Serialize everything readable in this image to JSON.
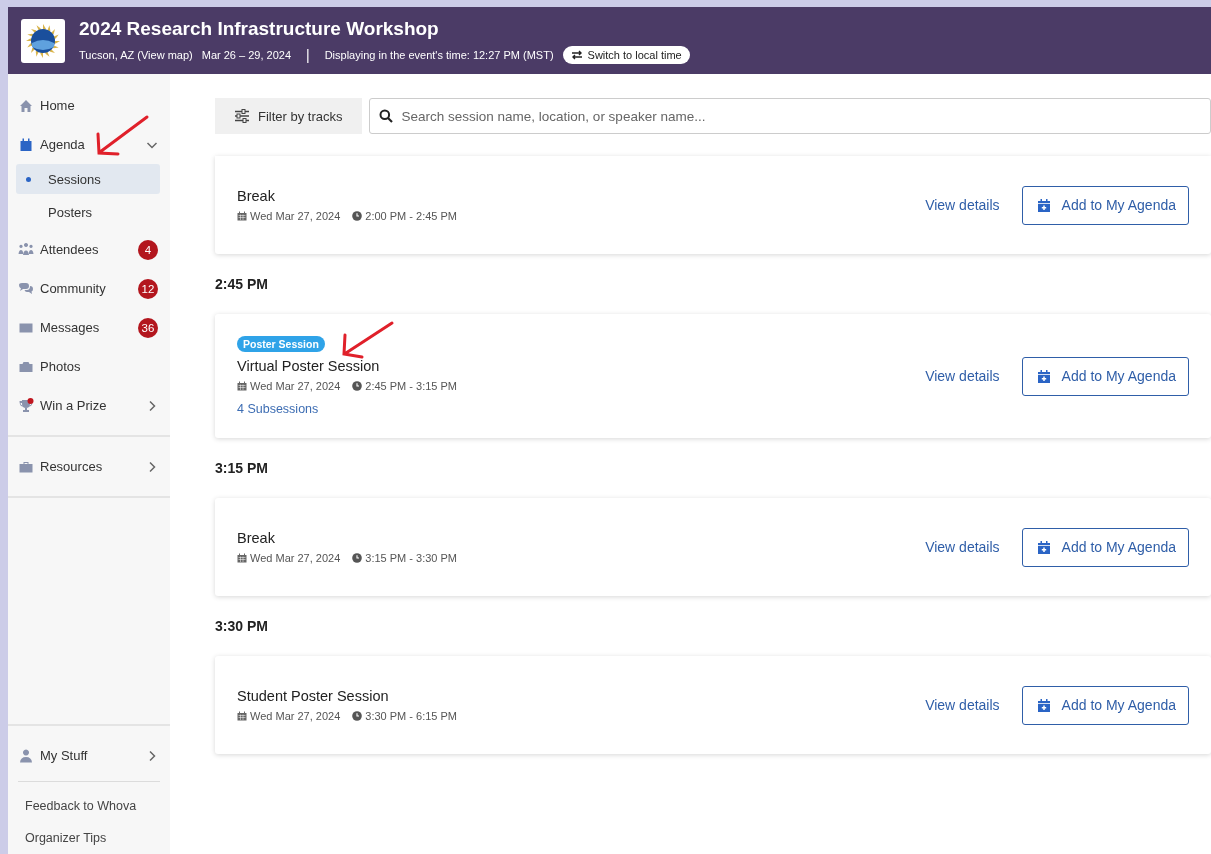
{
  "header": {
    "title": "2024 Research Infrastructure Workshop",
    "location": "Tucson, AZ (View map)",
    "dates": "Mar 26 – 29, 2024",
    "separator": "|",
    "timezone_note": "Displaying in the event's time: 12:27 PM (MST)",
    "switch_button": "Switch to local time"
  },
  "sidebar": {
    "groups": [
      [
        {
          "label": "Home",
          "kind": "home",
          "selected": false
        },
        {
          "label": "Agenda",
          "kind": "calendar",
          "selected": true,
          "expanded": true,
          "children": [
            {
              "label": "Sessions",
              "selected": true
            },
            {
              "label": "Posters",
              "selected": false
            }
          ]
        },
        {
          "label": "Attendees",
          "kind": "people",
          "selected": false,
          "badge": "4"
        },
        {
          "label": "Community",
          "kind": "chat",
          "selected": false,
          "badge": "12"
        },
        {
          "label": "Messages",
          "kind": "mail",
          "selected": false,
          "badge": "36"
        },
        {
          "label": "Photos",
          "kind": "camera",
          "selected": false
        },
        {
          "label": "Win a Prize",
          "kind": "trophy",
          "selected": false,
          "notification": true,
          "expanded": false
        }
      ],
      [
        {
          "label": "Resources",
          "kind": "briefcase",
          "selected": false,
          "expanded": false
        }
      ]
    ],
    "bottom": [
      {
        "label": "My Stuff",
        "kind": "person",
        "selected": false,
        "expanded": false
      }
    ],
    "links": [
      "Feedback to Whova",
      "Organizer Tips"
    ]
  },
  "toolbar": {
    "filter_button": "Filter by tracks",
    "search": {
      "placeholder": "Search session name, location, or speaker name..."
    }
  },
  "schedule": [
    {
      "kind": "session",
      "title": "Break",
      "date": "Wed Mar 27, 2024",
      "time": "2:00 PM - 2:45 PM",
      "details_link": "View details",
      "add_button": "Add to My Agenda"
    },
    {
      "kind": "time",
      "label": "2:45 PM"
    },
    {
      "kind": "session",
      "tag": "Poster Session",
      "title": "Virtual Poster Session",
      "date": "Wed Mar 27, 2024",
      "time": "2:45 PM - 3:15 PM",
      "subsessions": "4 Subsessions",
      "details_link": "View details",
      "add_button": "Add to My Agenda"
    },
    {
      "kind": "time",
      "label": "3:15 PM"
    },
    {
      "kind": "session",
      "title": "Break",
      "date": "Wed Mar 27, 2024",
      "time": "3:15 PM - 3:30 PM",
      "details_link": "View details",
      "add_button": "Add to My Agenda"
    },
    {
      "kind": "time",
      "label": "3:30 PM"
    },
    {
      "kind": "session",
      "title": "Student Poster Session",
      "date": "Wed Mar 27, 2024",
      "time": "3:30 PM - 6:15 PM",
      "details_link": "View details",
      "add_button": "Add to My Agenda"
    }
  ]
}
